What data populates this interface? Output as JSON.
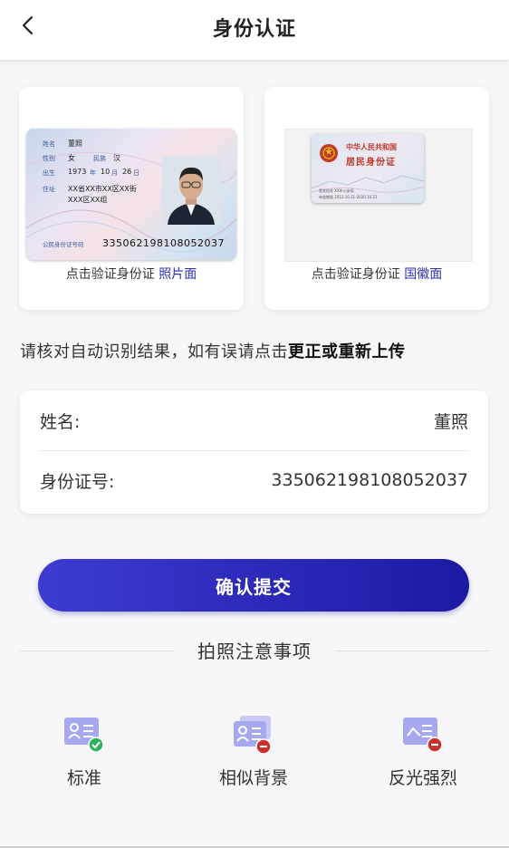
{
  "header": {
    "title": "身份认证"
  },
  "front_card": {
    "caption_prefix": "点击验证身份证 ",
    "caption_highlight": "照片面",
    "card": {
      "label_name": "姓名",
      "name": "董照",
      "label_gender": "性别",
      "gender": "女",
      "label_ethnicity": "民族",
      "ethnicity": "汉",
      "label_birth": "出生",
      "birth_year": "1973",
      "label_year": "年",
      "birth_month": "10",
      "label_month": "月",
      "birth_day": "26",
      "label_day": "日",
      "label_address": "住址",
      "address_line1": "XX省XX市XX区XX街",
      "address_line2": "XXX区XX组",
      "label_number": "公民身份证号码",
      "number": "335062198108052037"
    }
  },
  "back_card": {
    "caption_prefix": "点击验证身份证 ",
    "caption_highlight": "国徽面",
    "card": {
      "country": "中华人民共和国",
      "title": "居民身份证",
      "issuer_line": "签发机关  XX市公安局",
      "valid_line": "有效期限  2013.10.21-2020.10.21"
    }
  },
  "hint": {
    "prefix": "请核对自动识别结果，如有误请点击",
    "action": "更正或重新上传"
  },
  "info": {
    "name_label": "姓名:",
    "name_value": "董照",
    "id_label": "身份证号:",
    "id_value": "335062198108052037"
  },
  "confirm_label": "确认提交",
  "notes": {
    "title": "拍照注意事项",
    "items": [
      {
        "label": "标准",
        "icon": "standard-id-icon",
        "status": "ok"
      },
      {
        "label": "相似背景",
        "icon": "similar-background-icon",
        "status": "error"
      },
      {
        "label": "反光强烈",
        "icon": "strong-glare-icon",
        "status": "error"
      }
    ]
  },
  "colors": {
    "accent": "#2b2fb3",
    "button_start": "#3e3bd1",
    "button_end": "#1c1aa3",
    "ok": "#2fb35b",
    "error": "#c9302c"
  }
}
